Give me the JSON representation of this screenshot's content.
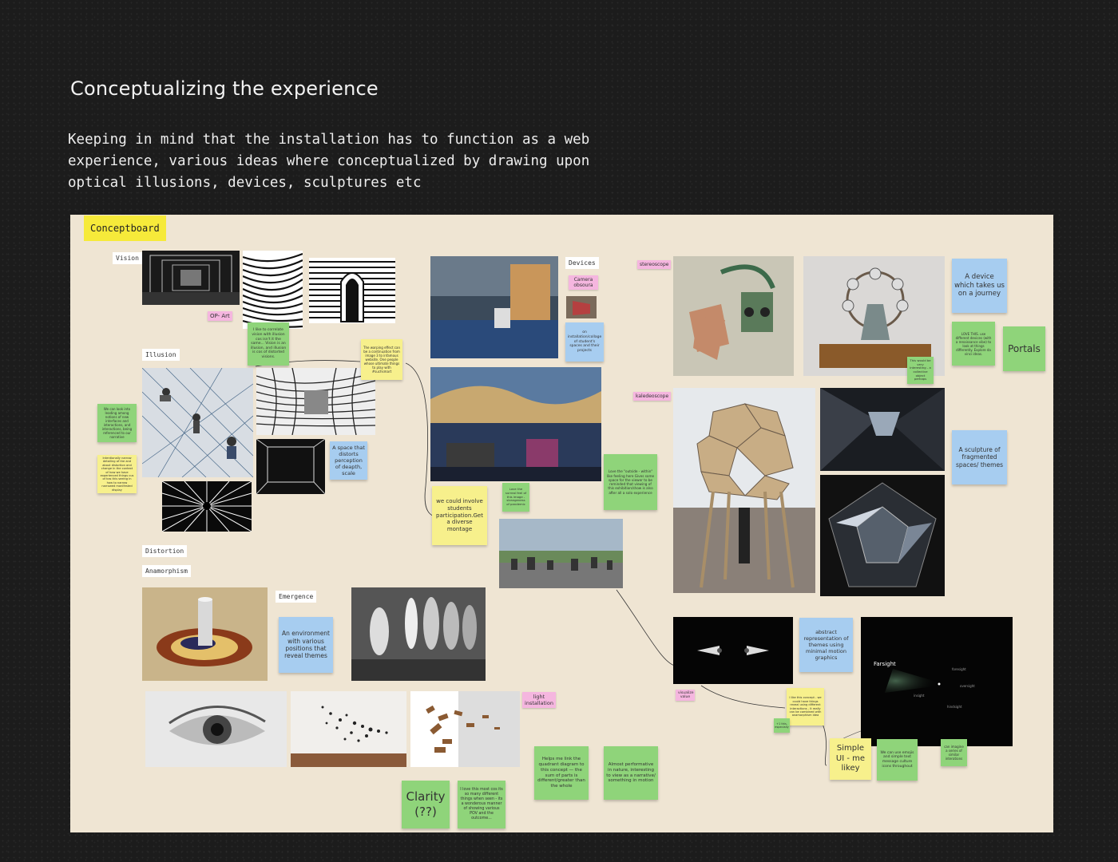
{
  "header": {
    "title": "Conceptualizing the experience",
    "intro": "Keeping in mind that the installation has to function as a web experience, various ideas where conceptualized by drawing upon optical illusions, devices, sculptures etc"
  },
  "board": {
    "title": "Conceptboard",
    "labels": {
      "vision": "Vision",
      "illusion": "Illusion",
      "distortion": "Distortion",
      "anamorphism": "Anamorphism",
      "emergence": "Emergence",
      "devices": "Devices"
    },
    "tags": {
      "op_art": "OP- Art",
      "camera_obscura": "Camera obsoura",
      "stereoscope": "stereoscope",
      "kaleidoscope": "kaledeoscope",
      "light_installation": "light installation",
      "visualize_value": "visualize value"
    },
    "notes": {
      "op_art_note": "I like to correlate vision with illusion cos isn't it the same... Vision is an illusion, and illusion is cos of distorted visions.",
      "warping_note": "The warping effect can be a continuation from image 3 to infamous website. One people whose ultimate things to play with #suchsmart",
      "illusion_green": "We can look into leading among notions of new interfaces and interactions, and interactions, being referenced to our narrative",
      "illusion_yellow": "Intentionally narrow detailing of the and about distortion and change in the context of how we have experienced things cus of has this seeing in how to narrow narrowed manifested display",
      "space_distorts": "A space that distorts perception of deapth, scale",
      "students": "we could involve students participation.Get a diverse montage",
      "camera_obscura_note": "on installation/collage of student's spaces and their projects",
      "surreal": "Love the surreal feel of this image - strangeness of pandemic",
      "outside_within": "Love the \"outside - within\" like feeling here\n\nGives some space for the viewer to be reminded that viewing of this exhibition/show is also after all a solo experience",
      "device_journey": "A device which takes us on a journey",
      "love_this": "LOVE THIS. use different devices (with a renaissance vibe) to look at things differently. Explore da vinci ideas.",
      "very_interesting": "This would be very interesting - a collective object perhaps",
      "portals": "Portals",
      "sculpture": "A sculpture of fragmented spaces/ themes",
      "environment": "An environment with various positions that reveal themes",
      "quadrant": "Helps me link the quadrant diagram to this concept — the sum of parts is different/greater than the whole",
      "performative": "Almost performative in nature, interesting to view as a narrative/ something in motion",
      "clarity": "Clarity (??)",
      "love_this_most": "I love this most cos its so many different things when seen - its a wonderous manner of showing various POV and the outcome...",
      "abstract": "abstract representation of themes using minimal motion graphics",
      "one_concept": "I like this concept - we could have things reveal using different interactions - it really can be combined with anamorphism idea",
      "plus_one": "+1 this, especially",
      "simple_ui": "Simple UI - me likey",
      "emojis": "We can use emojis and simple text message culture icons throughout",
      "series": "can imagine a series of similar interations"
    },
    "farsight": {
      "title": "Farsight",
      "t1": "foresight",
      "t2": "oversight",
      "t3": "insight",
      "t4": "hindsight"
    }
  },
  "colors": {
    "background": "#1c1c1c",
    "board": "#efe5d3",
    "title_tag": "#f6ea3a",
    "green_note": "#8fd47a",
    "yellow_note": "#f7f08c",
    "blue_note": "#a7cdf0",
    "pink_tag": "#f5b6df"
  }
}
